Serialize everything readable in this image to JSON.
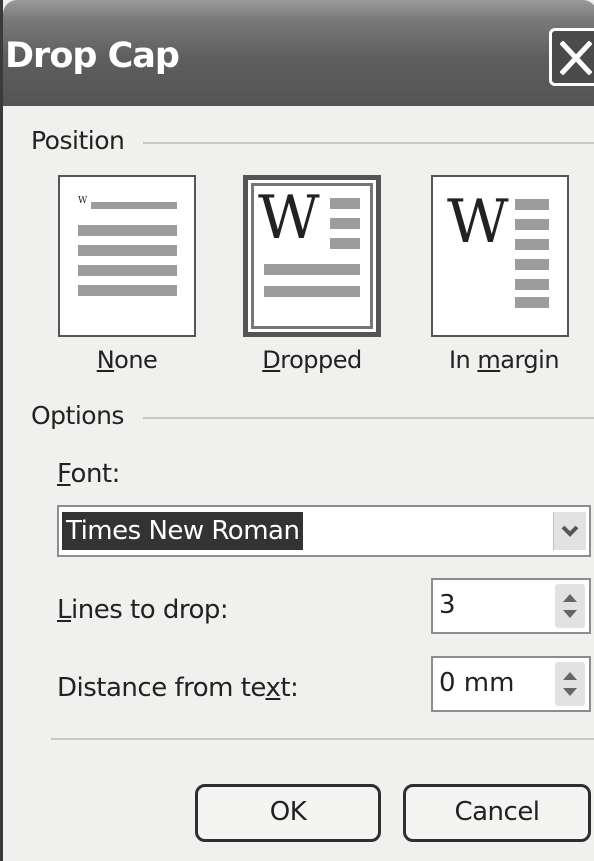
{
  "window": {
    "title": "Drop Cap"
  },
  "position": {
    "label": "Position",
    "options": [
      {
        "label": "None",
        "accesskey": "N",
        "selected": false
      },
      {
        "label": "Dropped",
        "accesskey": "D",
        "selected": true
      },
      {
        "label": "In margin",
        "accesskey": "m",
        "selected": false
      }
    ],
    "preview_small_letter": "W",
    "preview_letter": "W"
  },
  "options": {
    "label": "Options",
    "font_label": "Font:",
    "font_value": "Times New Roman",
    "lines_label": "Lines to drop:",
    "lines_value": "3",
    "distance_label": "Distance from text:",
    "distance_value": "0 mm"
  },
  "buttons": {
    "ok": "OK",
    "cancel": "Cancel"
  },
  "colors": {
    "titlebar": "#5e5e5e",
    "dialog_bg": "#f0f0ee",
    "selection": "#333333"
  },
  "icons": [
    "close-icon",
    "chevron-down-icon",
    "spin-up-icon",
    "spin-down-icon"
  ]
}
